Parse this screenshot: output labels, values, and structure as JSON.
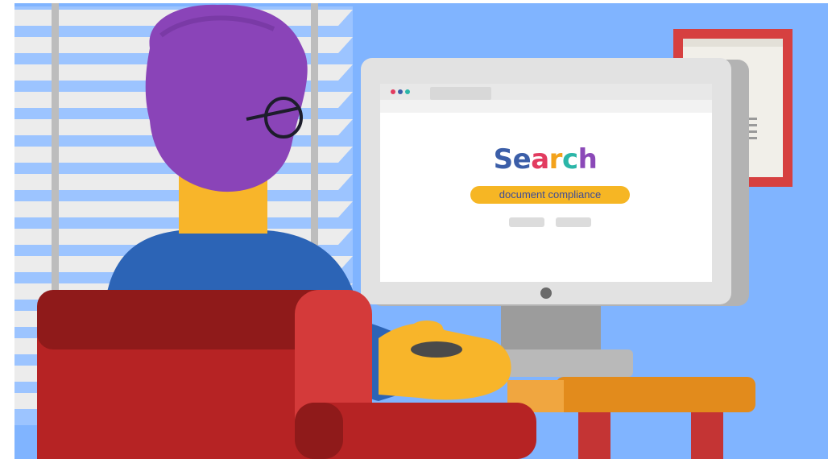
{
  "search": {
    "title_letters": [
      {
        "ch": "S",
        "color": "#3b5ea8"
      },
      {
        "ch": "e",
        "color": "#3b5ea8"
      },
      {
        "ch": "a",
        "color": "#e23b5f"
      },
      {
        "ch": "r",
        "color": "#f3a21b"
      },
      {
        "ch": "c",
        "color": "#2bb6a8"
      },
      {
        "ch": "h",
        "color": "#8b49b8"
      }
    ],
    "query": "document compliance"
  },
  "colors": {
    "wall": "#80b4ff",
    "hair": "#8a44b8",
    "skin": "#f8b52a",
    "shirt": "#2c64b6",
    "chair": "#b62324",
    "desk": "#e28b1c",
    "frame": "#d64040"
  }
}
